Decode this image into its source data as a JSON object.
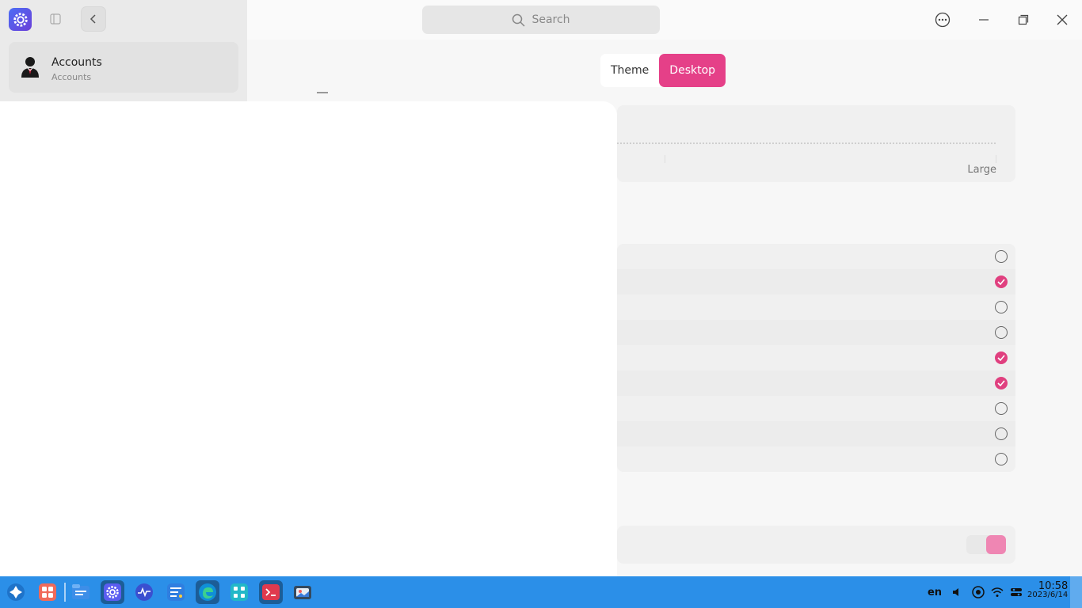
{
  "window": {
    "title": "Settings"
  },
  "sidebar": {
    "items": [
      {
        "label": "Accounts",
        "sublabel": "Accounts",
        "icon": "user-avatar-icon"
      }
    ]
  },
  "header": {
    "search_placeholder": "Search"
  },
  "tabs": [
    {
      "label": "Theme",
      "active": false
    },
    {
      "label": "Desktop",
      "active": true
    }
  ],
  "slider": {
    "max_label": "Large"
  },
  "list": {
    "rows": [
      {
        "checked": false
      },
      {
        "checked": true
      },
      {
        "checked": false
      },
      {
        "checked": false
      },
      {
        "checked": true
      },
      {
        "checked": true
      },
      {
        "checked": false
      },
      {
        "checked": false
      },
      {
        "checked": false
      }
    ]
  },
  "toggle": {
    "on": true
  },
  "colors": {
    "accent": "#e54088",
    "taskbar": "#2b8fe8"
  },
  "taskbar": {
    "apps": [
      {
        "name": "launcher-icon",
        "active": false
      },
      {
        "name": "app-grid-icon",
        "active": false
      },
      {
        "name": "file-manager-icon",
        "active": false
      },
      {
        "name": "settings-icon",
        "active": true
      },
      {
        "name": "system-monitor-icon",
        "active": false
      },
      {
        "name": "text-editor-icon",
        "active": false
      },
      {
        "name": "edge-browser-icon",
        "active": true
      },
      {
        "name": "app-store-icon",
        "active": false
      },
      {
        "name": "terminal-icon",
        "active": true
      },
      {
        "name": "image-viewer-icon",
        "active": false
      }
    ],
    "tray": {
      "language": "en",
      "time": "10:58",
      "date": "2023/6/14"
    }
  }
}
